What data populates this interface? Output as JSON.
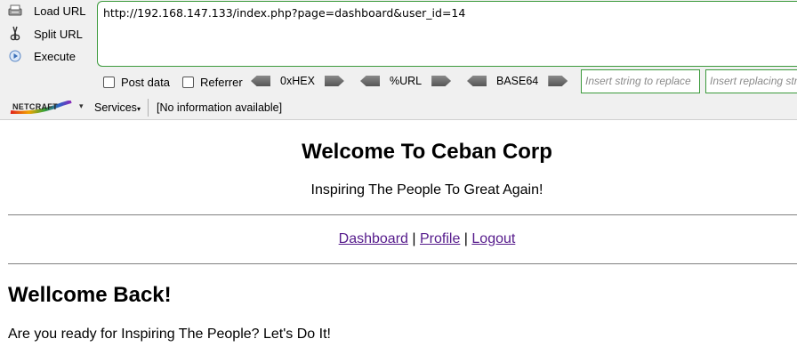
{
  "hackbar": {
    "actions": [
      {
        "label": "Load URL",
        "icon": "load-url-icon"
      },
      {
        "label": "Split URL",
        "icon": "split-url-icon"
      },
      {
        "label": "Execute",
        "icon": "execute-icon"
      }
    ],
    "url": "http://192.168.147.133/index.php?page=dashboard&user_id=14",
    "options": {
      "post_data": "Post data",
      "referrer": "Referrer",
      "hex": "0xHEX",
      "url_enc": "%URL",
      "base64": "BASE64"
    },
    "insert_replace_placeholder": "Insert string to replace",
    "insert_replacing_placeholder": "Insert replacing string"
  },
  "netcraft": {
    "logo_text": "NETCRAFT",
    "services": "Services",
    "info": "[No information available]"
  },
  "page": {
    "title": "Welcome To Ceban Corp",
    "subtitle": "Inspiring The People To Great Again!",
    "nav": {
      "dashboard": "Dashboard",
      "sep1": " | ",
      "profile": "Profile",
      "sep2": " | ",
      "logout": "Logout"
    },
    "heading": "Wellcome Back!",
    "message": "Are you ready for Inspiring The People? Let's Do It!"
  }
}
